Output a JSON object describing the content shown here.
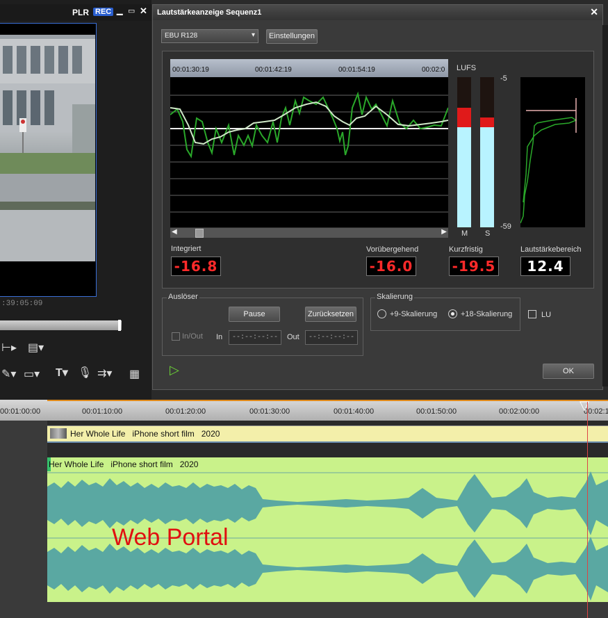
{
  "player": {
    "plr_label": "PLR",
    "rec_label": "REC",
    "min_icon": "minimize-icon",
    "max_icon": "maximize-icon",
    "close_icon": "close-icon",
    "timecode": ":39:05:09"
  },
  "dialog": {
    "title": "Lautstärkeanzeige  Sequenz1",
    "close": "✕",
    "preset": "EBU R128",
    "settings_button": "Einstellungen",
    "graph_ticks": [
      "00:01:30:19",
      "00:01:42:19",
      "00:01:54:19",
      "00:02:0"
    ],
    "lufs_label": "LUFS",
    "scale_top": "-5",
    "scale_bottom": "-59",
    "meter_m": "M",
    "meter_s": "S",
    "integrated_label": "Integriert",
    "integrated_value": "-16.8",
    "momentary_label": "Vorübergehend",
    "momentary_value": "-16.0",
    "shortterm_label": "Kurzfristig",
    "shortterm_value": "-19.5",
    "range_label": "Lautstärkebereich",
    "range_value": "12.4",
    "trigger_group": "Auslöser",
    "pause_button": "Pause",
    "reset_button": "Zurücksetzen",
    "inout_label": "In/Out",
    "in_label": "In",
    "in_value": "--:--:--:--",
    "out_label": "Out",
    "out_value": "--:--:--:--",
    "scaling_group": "Skalierung",
    "scale9": "+9-Skalierung",
    "scale18": "+18-Skalierung",
    "lu_label": "LU",
    "ok_button": "OK"
  },
  "timeline": {
    "ticks": [
      "00:01:00:00",
      "00:01:10:00",
      "00:01:20:00",
      "00:01:30:00",
      "00:01:40:00",
      "00:01:50:00",
      "00:02:00:00",
      "00:02:1"
    ],
    "video_clip_title": "Her Whole Life   iPhone short film   2020",
    "audio_clip_title": "Her Whole Life   iPhone short film   2020",
    "watermark": "Web Portal"
  },
  "colors": {
    "accent_blue": "#2a5fd0",
    "meter_red": "#ff2a2a",
    "meter_cyan": "#b8f3ff",
    "waveform": "#5aa8a2",
    "audio_bg": "#c9f28a",
    "video_bg": "#f3efaa"
  }
}
